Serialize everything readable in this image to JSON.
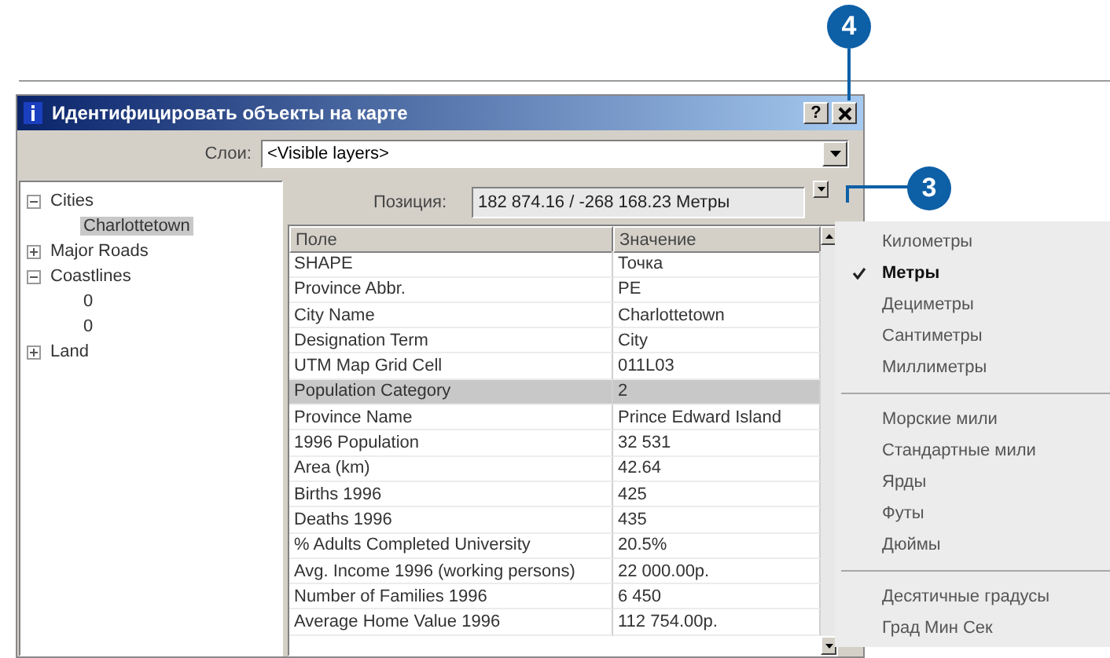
{
  "callouts": [
    {
      "label": "4"
    },
    {
      "label": "3"
    }
  ],
  "window": {
    "title": "Идентифицировать объекты на карте",
    "help": "?"
  },
  "layers": {
    "label": "Слои:",
    "value": "<Visible layers>"
  },
  "tree": [
    {
      "label": "Cities",
      "expanded": true,
      "selected": false,
      "children": [
        {
          "label": "Charlottetown",
          "selected": true
        }
      ]
    },
    {
      "label": "Major Roads",
      "expanded": false,
      "selected": false
    },
    {
      "label": "Coastlines",
      "expanded": true,
      "selected": false,
      "children": [
        {
          "label": "0",
          "selected": false
        },
        {
          "label": "0",
          "selected": false
        }
      ]
    },
    {
      "label": "Land",
      "expanded": false,
      "selected": false
    }
  ],
  "position": {
    "label": "Позиция:",
    "value": "182 874.16 / -268 168.23 Метры"
  },
  "table": {
    "columns": [
      "Поле",
      "Значение"
    ],
    "rows": [
      {
        "field": "SHAPE",
        "value": "Точка",
        "selected": false
      },
      {
        "field": "Province Abbr.",
        "value": "PE",
        "selected": false
      },
      {
        "field": "City Name",
        "value": "Charlottetown",
        "selected": false
      },
      {
        "field": "Designation Term",
        "value": "City",
        "selected": false
      },
      {
        "field": "UTM Map Grid Cell",
        "value": "011L03",
        "selected": false
      },
      {
        "field": "Population Category",
        "value": "2",
        "selected": true
      },
      {
        "field": "Province Name",
        "value": "Prince Edward Island",
        "selected": false
      },
      {
        "field": "1996 Population",
        "value": "32 531",
        "selected": false
      },
      {
        "field": "Area (km)",
        "value": "42.64",
        "selected": false
      },
      {
        "field": "Births 1996",
        "value": "425",
        "selected": false
      },
      {
        "field": "Deaths 1996",
        "value": "435",
        "selected": false
      },
      {
        "field": "% Adults Completed University",
        "value": "20.5%",
        "selected": false
      },
      {
        "field": "Avg. Income 1996 (working persons)",
        "value": "22 000.00р.",
        "selected": false
      },
      {
        "field": "Number of Families 1996",
        "value": "6 450",
        "selected": false
      },
      {
        "field": "Average Home Value 1996",
        "value": "112 754.00р.",
        "selected": false
      }
    ]
  },
  "units_menu": {
    "groups": [
      [
        {
          "label": "Километры",
          "checked": false
        },
        {
          "label": "Метры",
          "checked": true
        },
        {
          "label": "Дециметры",
          "checked": false
        },
        {
          "label": "Сантиметры",
          "checked": false
        },
        {
          "label": "Миллиметры",
          "checked": false
        }
      ],
      [
        {
          "label": "Морские мили",
          "checked": false
        },
        {
          "label": "Стандартные мили",
          "checked": false
        },
        {
          "label": "Ярды",
          "checked": false
        },
        {
          "label": "Футы",
          "checked": false
        },
        {
          "label": "Дюймы",
          "checked": false
        }
      ],
      [
        {
          "label": "Десятичные градусы",
          "checked": false
        },
        {
          "label": "Град Мин Сек",
          "checked": false
        }
      ]
    ]
  }
}
